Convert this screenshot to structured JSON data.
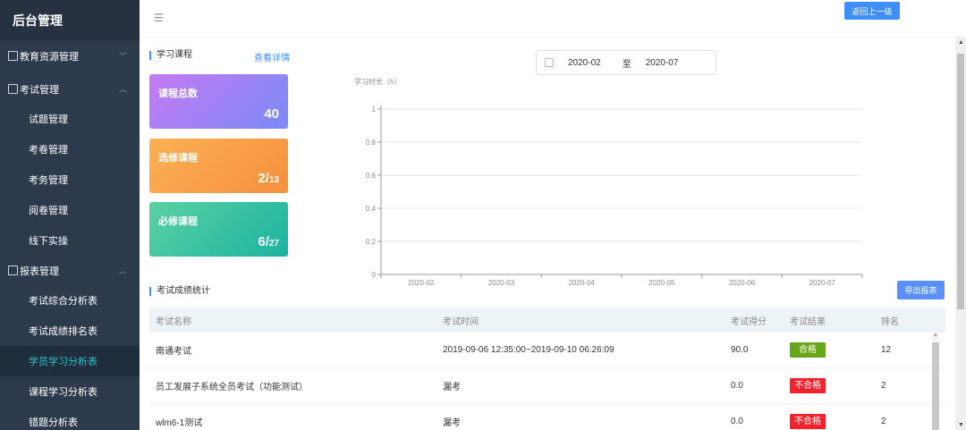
{
  "sidebar": {
    "brand": "后台管理",
    "groups": [
      {
        "label": "教育资源管理",
        "icon": "monitor-icon"
      },
      {
        "label": "考试管理",
        "icon": "form-icon"
      },
      {
        "label": "报表管理",
        "icon": "chart-icon"
      }
    ],
    "exam_items": [
      "试题管理",
      "考卷管理",
      "考务管理",
      "阅卷管理",
      "线下实操"
    ],
    "report_items": [
      "考试综合分析表",
      "考试成绩排名表",
      "学员学习分析表",
      "课程学习分析表",
      "错题分析表"
    ],
    "active_item": "学员学习分析表"
  },
  "topbar": {
    "back_label": "返回上一级"
  },
  "course": {
    "title": "学习课程",
    "detail_link": "查看详情",
    "cards": [
      {
        "title": "课程总数",
        "value": "40",
        "total": ""
      },
      {
        "title": "选修课程",
        "value": "2/",
        "total": "13"
      },
      {
        "title": "必修课程",
        "value": "6/",
        "total": "27"
      }
    ]
  },
  "date_range": {
    "start": "2020-02",
    "sep": "至",
    "end": "2020-07"
  },
  "chart_data": {
    "type": "line",
    "ylabel": "学习时长（h）",
    "x": [
      "2020-02",
      "2020-03",
      "2020-04",
      "2020-05",
      "2020-06",
      "2020-07"
    ],
    "yticks": [
      "0",
      "0.2",
      "0.4",
      "0.6",
      "0.8",
      "1"
    ],
    "ylim": [
      0,
      1
    ],
    "grid": true,
    "series": []
  },
  "scores": {
    "title": "考试成绩统计",
    "export_label": "导出报表",
    "headers": [
      "考试名称",
      "考试时间",
      "考试得分",
      "考试结果",
      "排名"
    ],
    "rows": [
      {
        "name": "南通考试",
        "time": "2019-09-06 12:35:00~2019-09-10 06:26:09",
        "score": "90.0",
        "result": "合格",
        "rank": "12"
      },
      {
        "name": "员工发展子系统全员考试（功能测试）",
        "time": "漏考",
        "score": "0.0",
        "result": "不合格",
        "rank": "2"
      },
      {
        "name": "wlm6-1测试",
        "time": "漏考",
        "score": "0.0",
        "result": "不合格",
        "rank": "2"
      }
    ]
  },
  "colors": {
    "pass": "#67a61b",
    "fail": "#f5222d",
    "accent": "#3e8ef7"
  }
}
